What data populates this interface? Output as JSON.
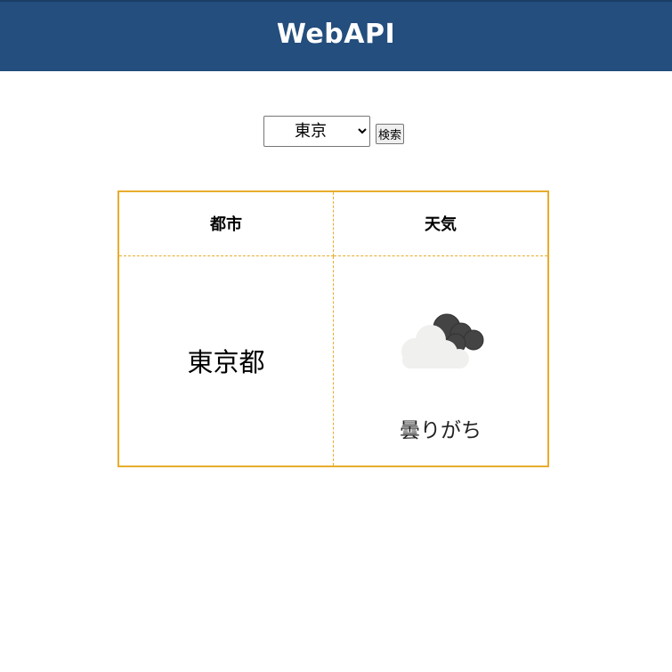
{
  "header": {
    "title": "WebAPI",
    "background_color": "#234e7d"
  },
  "search": {
    "selected_city": "東京",
    "options": [
      "東京"
    ],
    "button_label": "検索"
  },
  "table": {
    "border_color": "#e8ac2c",
    "headers": {
      "city": "都市",
      "weather": "天気"
    },
    "row": {
      "city": "東京都",
      "weather_icon": "cloudy-icon",
      "weather": "曇りがち"
    }
  }
}
